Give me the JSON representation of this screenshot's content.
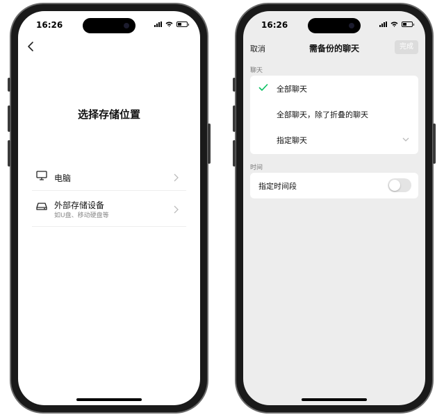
{
  "status_bar": {
    "time": "16:26"
  },
  "left_screen": {
    "title": "选择存储位置",
    "options": [
      {
        "label": "电脑",
        "icon": "monitor-icon"
      },
      {
        "label": "外部存储设备",
        "sublabel": "如U盘、移动硬盘等",
        "icon": "hard-drive-icon"
      }
    ]
  },
  "right_screen": {
    "nav": {
      "cancel": "取消",
      "title": "需备份的聊天",
      "done": "完成"
    },
    "chat_section": {
      "label": "聊天",
      "options": [
        {
          "label": "全部聊天",
          "selected": true
        },
        {
          "label": "全部聊天，除了折叠的聊天",
          "selected": false
        },
        {
          "label": "指定聊天",
          "selected": false
        }
      ]
    },
    "time_section": {
      "label": "时间",
      "toggle_label": "指定时间段",
      "toggle_on": false
    }
  },
  "colors": {
    "accent": "#07c160",
    "screen_gray": "#ededed"
  }
}
